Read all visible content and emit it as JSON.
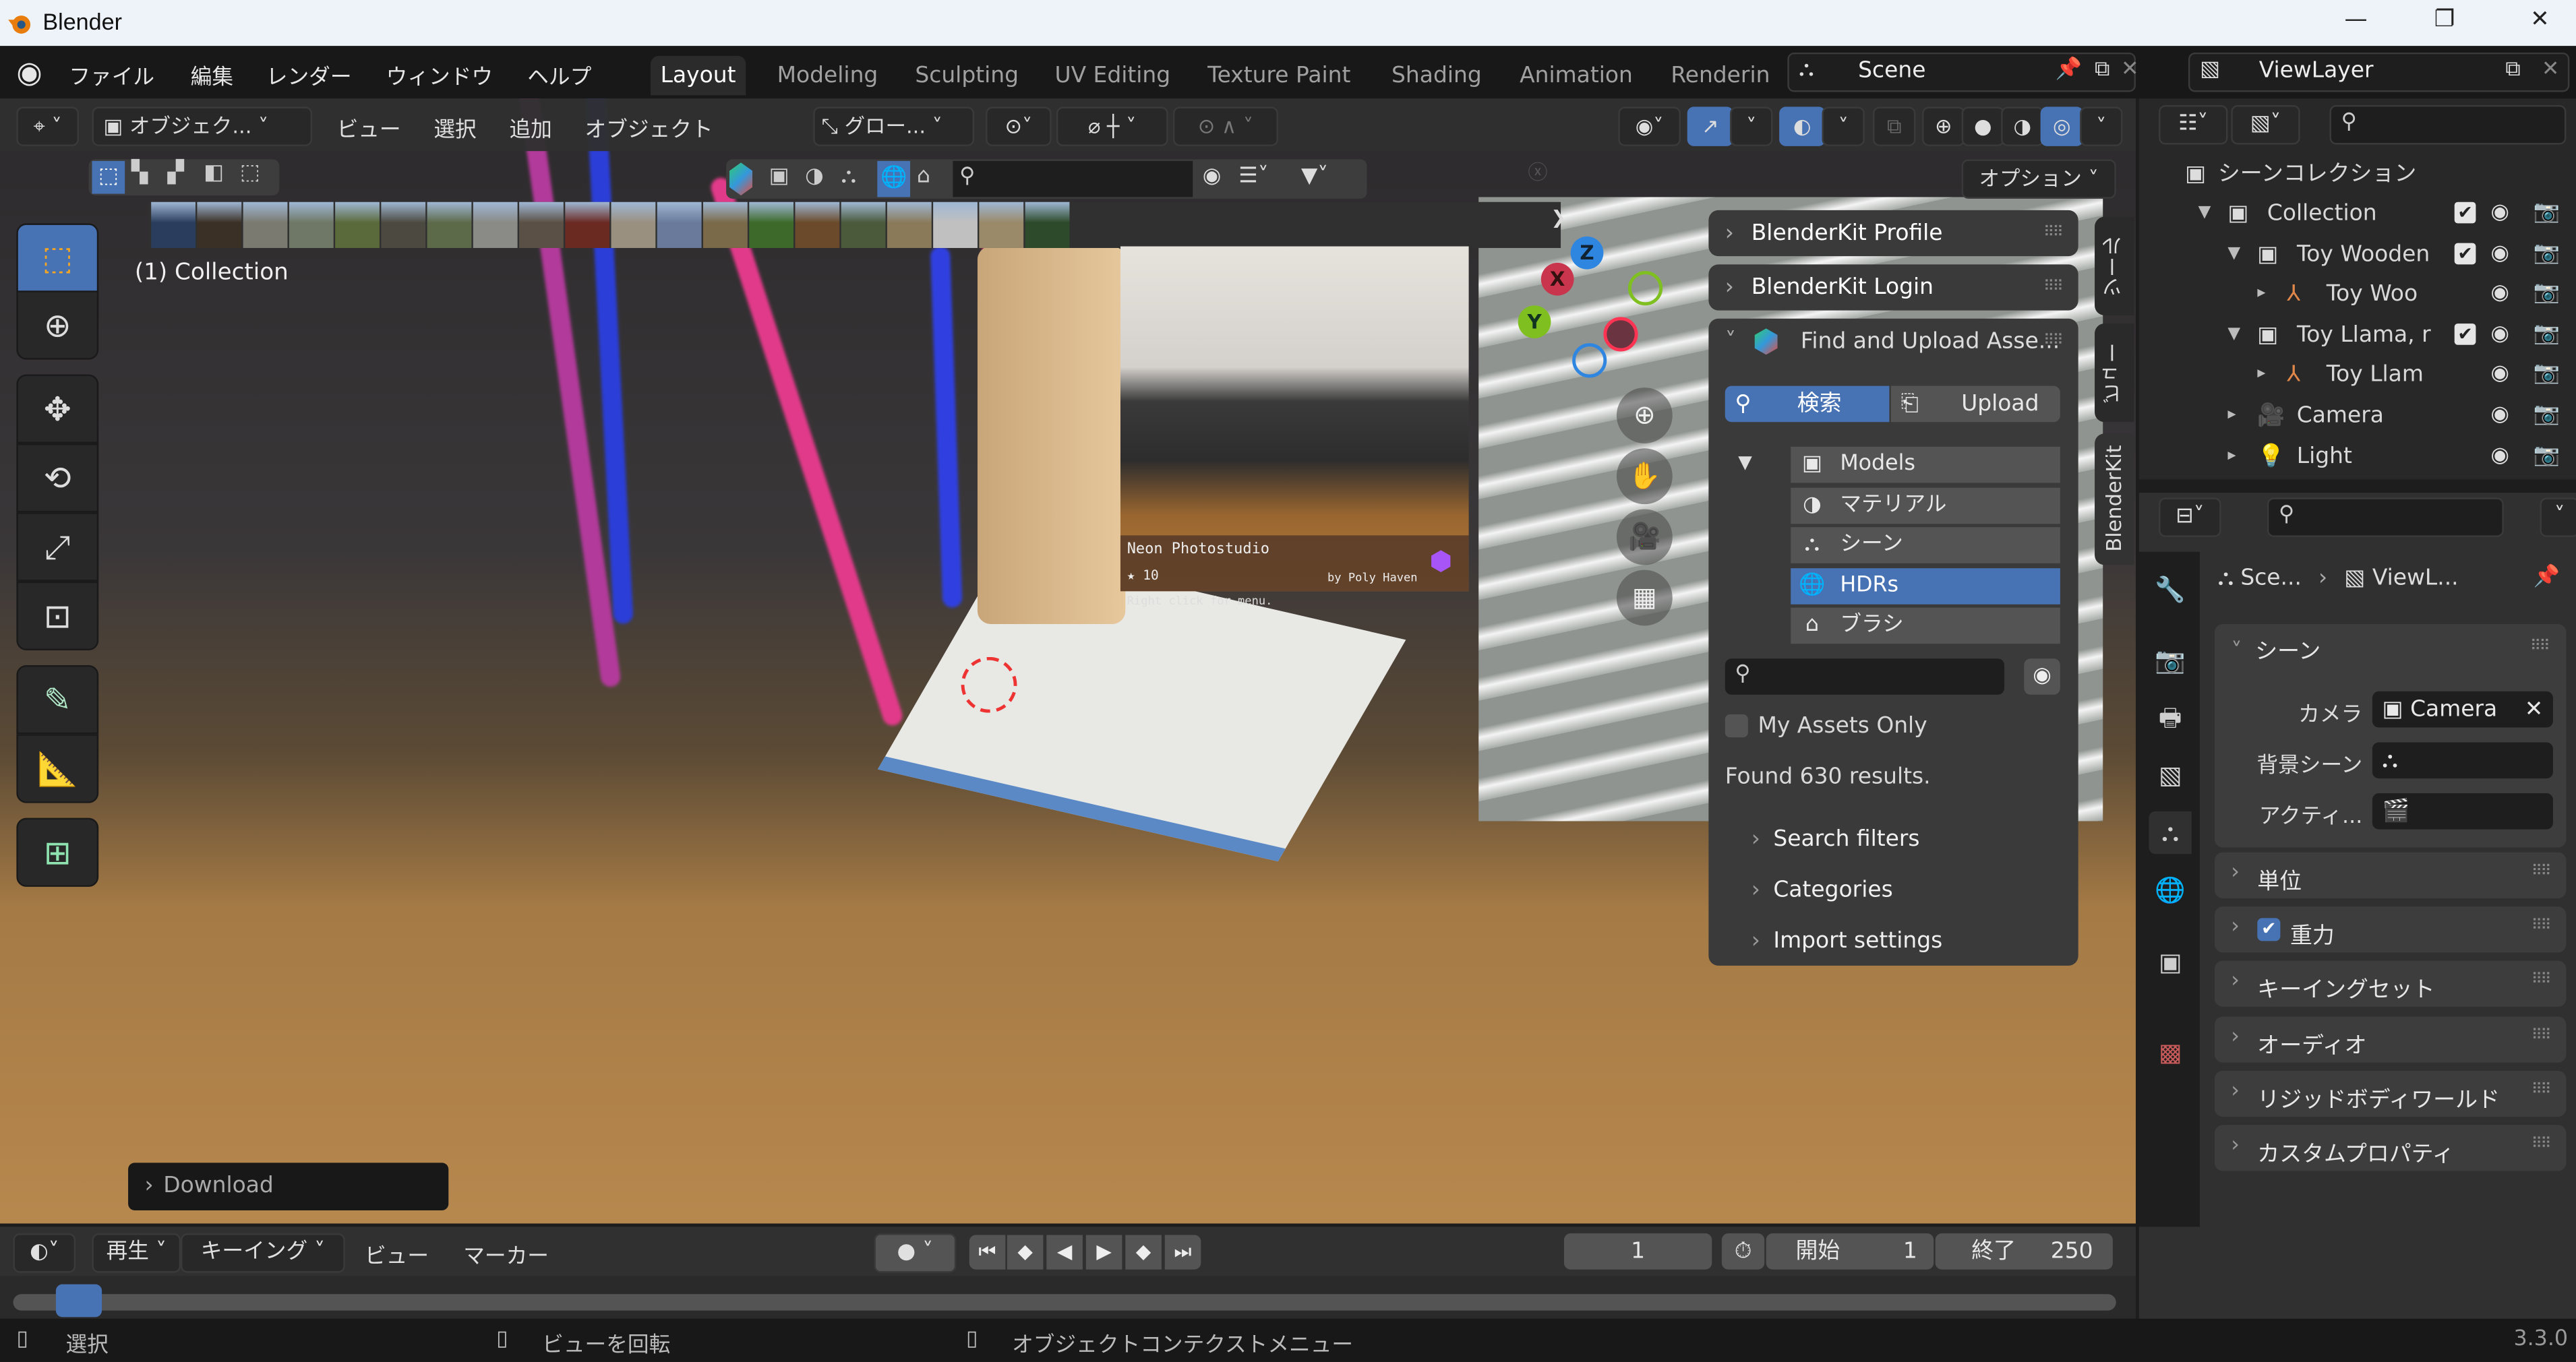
{
  "window": {
    "title": "Blender",
    "controls": [
      "minimize",
      "restore",
      "close"
    ]
  },
  "menu": {
    "items": [
      "ファイル",
      "編集",
      "レンダー",
      "ウィンドウ",
      "ヘルプ"
    ],
    "workspaces": [
      {
        "label": "Layout",
        "active": true
      },
      {
        "label": "Modeling"
      },
      {
        "label": "Sculpting"
      },
      {
        "label": "UV Editing"
      },
      {
        "label": "Texture Paint"
      },
      {
        "label": "Shading"
      },
      {
        "label": "Animation"
      },
      {
        "label": "Renderin"
      }
    ],
    "scene_name": "Scene",
    "view_layer_name": "ViewLayer"
  },
  "viewport_header": {
    "mode": "オブジェク...",
    "menus": [
      "ビュー",
      "選択",
      "追加",
      "オブジェクト"
    ],
    "transform_orientation": "グロー...",
    "options_label": "オプション"
  },
  "viewport": {
    "collection_label": "(1) Collection",
    "gizmo_axes": [
      "X",
      "Y",
      "Z"
    ],
    "download_panel": "Download",
    "colors": {
      "x_axis": "#c8354c",
      "y_axis": "#7fbf1f",
      "z_axis": "#2f86e0",
      "accent": "#4772b3"
    }
  },
  "asset_preview": {
    "name": "Neon Photostudio",
    "rating": "10",
    "author": "by Poly Haven",
    "hint": "Right click for menu."
  },
  "blenderkit": {
    "panels": {
      "profile": "BlenderKit Profile",
      "login": "BlenderKit Login",
      "find": "Find and Upload Asse..."
    },
    "tabs": {
      "search": "検索",
      "upload": "Upload"
    },
    "categories": [
      {
        "label": "Models",
        "icon": "object-icon"
      },
      {
        "label": "マテリアル",
        "icon": "material-icon"
      },
      {
        "label": "シーン",
        "icon": "scene-icon"
      },
      {
        "label": "HDRs",
        "icon": "world-icon",
        "selected": true
      },
      {
        "label": "ブラシ",
        "icon": "brush-icon"
      }
    ],
    "search_value": "",
    "my_assets_only": "My Assets Only",
    "my_assets_checked": false,
    "results": "Found 630 results.",
    "subpanels": [
      "Search filters",
      "Categories",
      "Import settings"
    ]
  },
  "side_tabs": [
    "ツール",
    "ビュー",
    "BlenderKit"
  ],
  "outliner": {
    "root": "シーンコレクション",
    "rows": [
      {
        "label": "Collection",
        "type": "collection",
        "checked": true
      },
      {
        "label": "Toy Wooden",
        "type": "collection",
        "checked": true
      },
      {
        "label": "Toy Woo",
        "type": "empty"
      },
      {
        "label": "Toy Llama, r",
        "type": "collection",
        "checked": true
      },
      {
        "label": "Toy Llam",
        "type": "empty"
      },
      {
        "label": "Camera",
        "type": "camera"
      },
      {
        "label": "Light",
        "type": "light"
      }
    ]
  },
  "properties": {
    "breadcrumb": [
      "Sce...",
      "ViewL..."
    ],
    "scene_section": "シーン",
    "fields": [
      {
        "label": "カメラ",
        "value": "Camera"
      },
      {
        "label": "背景シーン",
        "value": ""
      },
      {
        "label": "アクティ...",
        "value": ""
      }
    ],
    "sections": [
      {
        "label": "単位"
      },
      {
        "label": "重力",
        "checkbox": true
      },
      {
        "label": "キーイングセット"
      },
      {
        "label": "オーディオ"
      },
      {
        "label": "リジッドボディワールド"
      },
      {
        "label": "カスタムプロパティ"
      }
    ]
  },
  "timeline": {
    "menus": [
      "再生",
      "キーイング",
      "ビュー",
      "マーカー"
    ],
    "current_frame": "1",
    "start_label": "開始",
    "start": "1",
    "end_label": "終了",
    "end": "250"
  },
  "statusbar": {
    "left": "選択",
    "middle": "ビューを回転",
    "right": "オブジェクトコンテクストメニュー",
    "version": "3.3.0"
  }
}
